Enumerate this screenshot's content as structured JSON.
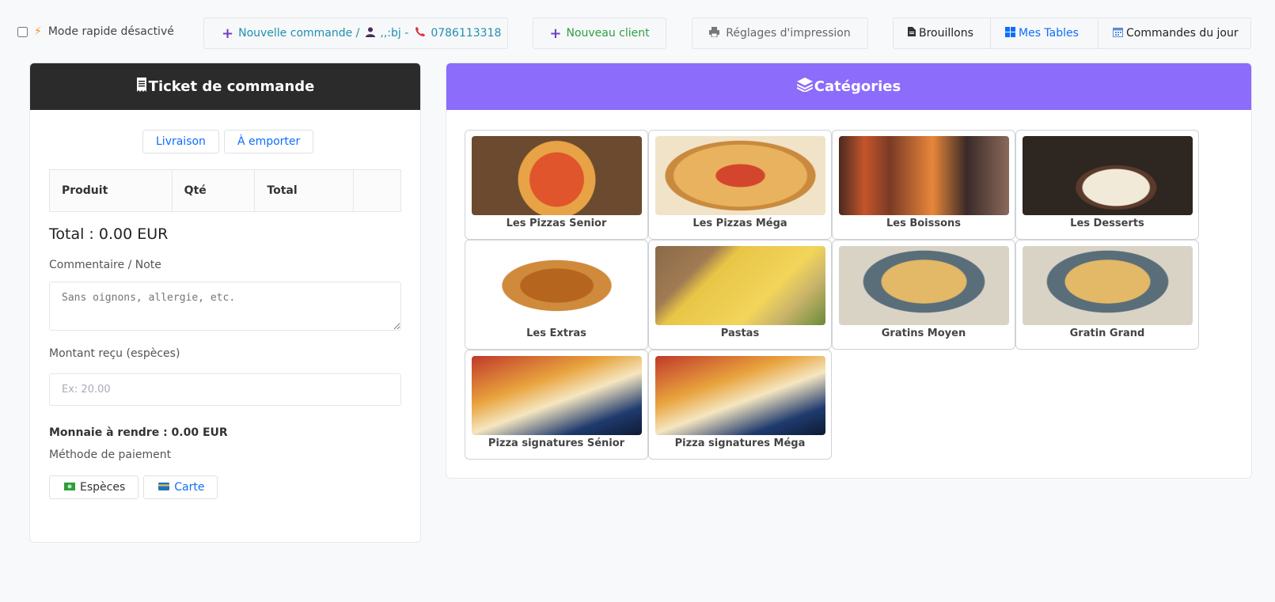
{
  "topbar": {
    "fast_mode_label": "Mode rapide désactivé",
    "new_order_label": "Nouvelle commande /",
    "client_name": ",,:bj -",
    "client_phone": "0786113318",
    "new_client_label": "Nouveau client",
    "print_settings_label": "Réglages d'impression",
    "drafts_label": "Brouillons",
    "tables_label": "Mes Tables",
    "today_orders_label": "Commandes du jour"
  },
  "ticket": {
    "title": "Ticket de commande",
    "tabs": [
      "Livraison",
      "À emporter"
    ],
    "columns": [
      "Produit",
      "Qté",
      "Total",
      ""
    ],
    "total_line": "Total : 0.00 EUR",
    "comment_label": "Commentaire / Note",
    "comment_placeholder": "Sans oignons, allergie, etc.",
    "cash_label": "Montant reçu (espèces)",
    "cash_placeholder": "Ex: 20.00",
    "change_line": "Monnaie à rendre : 0.00 EUR",
    "payment_label": "Méthode de paiement",
    "pay_cash": "Espèces",
    "pay_card": "Carte"
  },
  "categories": {
    "title": "Catégories",
    "items": [
      {
        "label": "Les Pizzas Senior"
      },
      {
        "label": "Les Pizzas Méga"
      },
      {
        "label": "Les Boissons"
      },
      {
        "label": "Les Desserts"
      },
      {
        "label": "Les Extras"
      },
      {
        "label": "Pastas"
      },
      {
        "label": "Gratins Moyen"
      },
      {
        "label": "Gratin Grand"
      },
      {
        "label": "Pizza signatures Sénior"
      },
      {
        "label": "Pizza signatures Méga"
      }
    ]
  },
  "colors": {
    "ticket_header": "#2b2b2b",
    "categories_header": "#8b6cfb",
    "link_blue": "#0d6efd"
  }
}
